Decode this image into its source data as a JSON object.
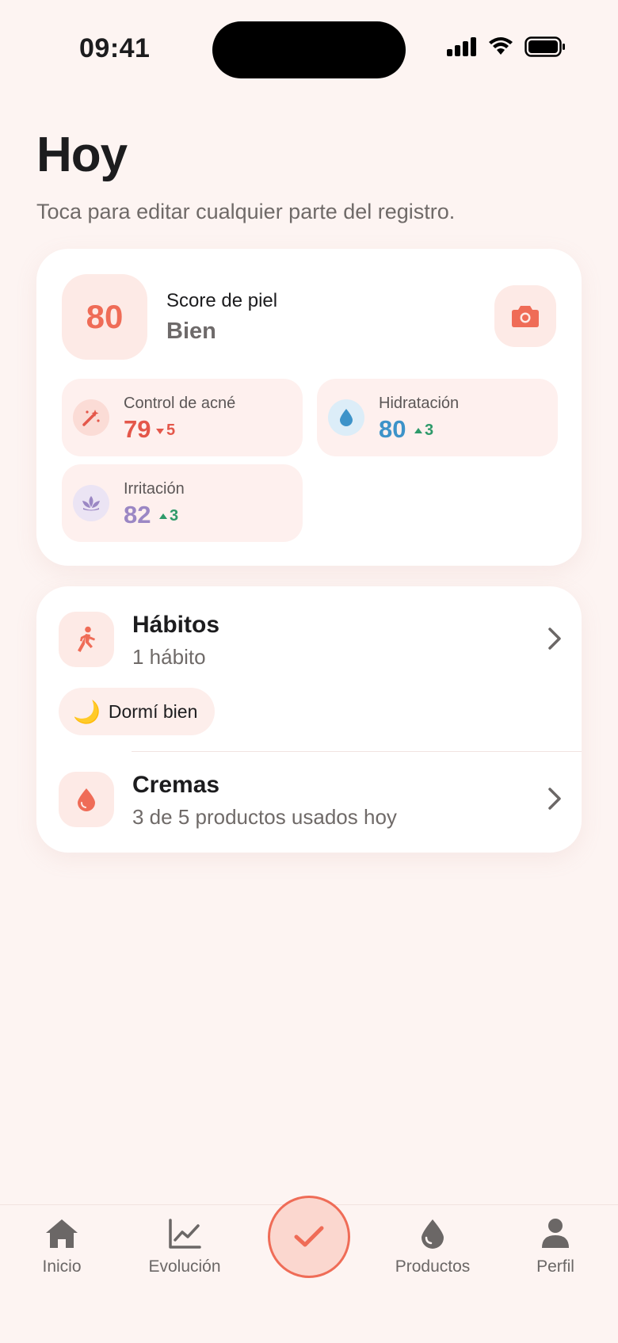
{
  "status": {
    "time": "09:41"
  },
  "header": {
    "title": "Hoy",
    "subtitle": "Toca para editar cualquier parte del registro."
  },
  "score": {
    "value": "80",
    "label": "Score de piel",
    "status": "Bien",
    "metrics": [
      {
        "label": "Control de acné",
        "value": "79",
        "delta": "5",
        "direction": "down",
        "color": "#e4574a"
      },
      {
        "label": "Hidratación",
        "value": "80",
        "delta": "3",
        "direction": "up",
        "color": "#3d93c9"
      },
      {
        "label": "Irritación",
        "value": "82",
        "delta": "3",
        "direction": "up",
        "color": "#9b87c4"
      }
    ]
  },
  "habits": {
    "title": "Hábitos",
    "subtitle": "1 hábito",
    "chip_emoji": "🌙",
    "chip_label": "Dormí bien"
  },
  "creams": {
    "title": "Cremas",
    "subtitle": "3 de 5 productos usados hoy"
  },
  "tabs": [
    {
      "label": "Inicio",
      "icon": "home-icon"
    },
    {
      "label": "Evolución",
      "icon": "chart-icon"
    },
    {
      "label": "",
      "icon": "check-icon"
    },
    {
      "label": "Productos",
      "icon": "drop-icon"
    },
    {
      "label": "Perfil",
      "icon": "person-icon"
    }
  ],
  "colors": {
    "accent": "#ef6c57",
    "background": "#fdf4f2",
    "delta_down": "#e4574a",
    "delta_up": "#2e9a6a"
  }
}
